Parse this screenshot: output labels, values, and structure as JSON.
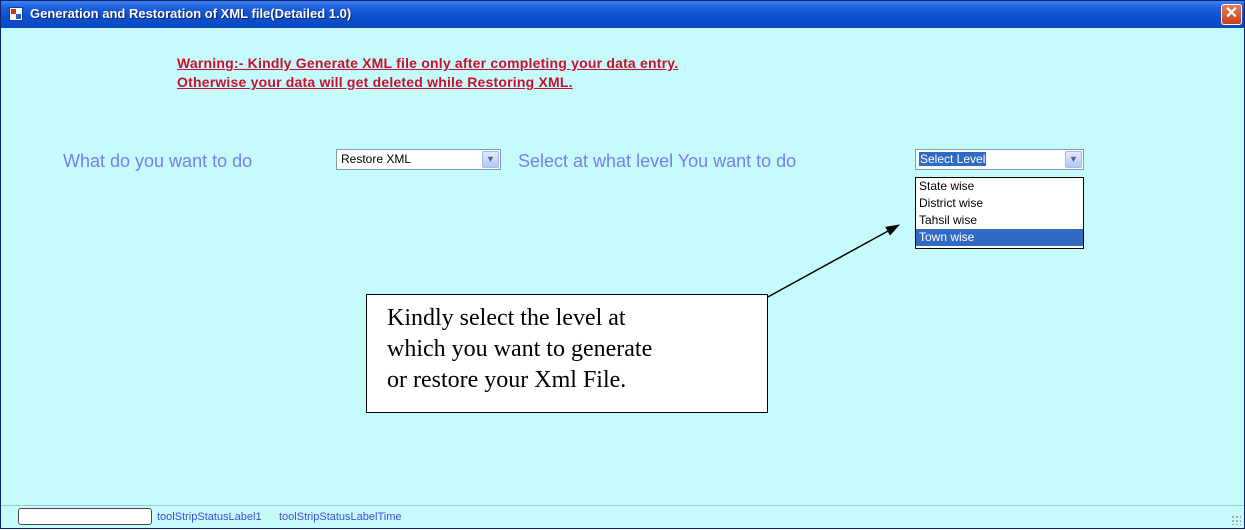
{
  "window": {
    "title": "Generation and Restoration of XML file(Detailed 1.0)",
    "close_glyph": "✕"
  },
  "warning": {
    "line1": "Warning:- Kindly Generate XML file only after completing your data entry.",
    "line2": "Otherwise your data will get deleted while Restoring XML."
  },
  "form": {
    "action_label": "What do you want to do",
    "action_value": "Restore XML",
    "level_label": "Select at what level You want to do",
    "level_value": "Select Level",
    "combo_arrow": "▼",
    "level_options": [
      "State wise",
      "District wise",
      "Tahsil wise",
      "Town wise"
    ],
    "highlighted_option": "Town wise"
  },
  "callout": {
    "line1": "Kindly select the level at",
    "line2": "which you want to generate",
    "line3": "or restore your Xml File."
  },
  "statusbar": {
    "label1": "toolStripStatusLabel1",
    "label2": "toolStripStatusLabelTime"
  },
  "colors": {
    "background": "#c6fbfb",
    "warning": "#c8102e",
    "label": "#7b7bf0",
    "selection": "#316ac5",
    "titlebar": "#0a4fd0"
  },
  "icons": {
    "app": "app-icon",
    "close": "close-icon",
    "dropdown": "chevron-down-icon"
  }
}
